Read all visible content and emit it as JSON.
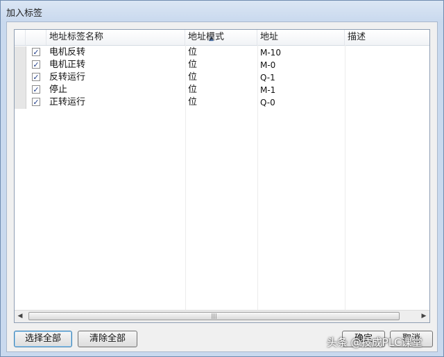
{
  "window": {
    "title": "加入标签"
  },
  "table": {
    "columns": [
      {
        "label": "地址标签名称"
      },
      {
        "label": "地址模式"
      },
      {
        "label": "地址"
      },
      {
        "label": "描述"
      }
    ],
    "rows": [
      {
        "checked": true,
        "check_mark": "✓",
        "name": "电机反转",
        "mode": "位",
        "address": "M-10",
        "desc": ""
      },
      {
        "checked": true,
        "check_mark": "✓",
        "name": "电机正转",
        "mode": "位",
        "address": "M-0",
        "desc": ""
      },
      {
        "checked": true,
        "check_mark": "✓",
        "name": "反转运行",
        "mode": "位",
        "address": "Q-1",
        "desc": ""
      },
      {
        "checked": true,
        "check_mark": "✓",
        "name": "停止",
        "mode": "位",
        "address": "M-1",
        "desc": ""
      },
      {
        "checked": true,
        "check_mark": "✓",
        "name": "正转运行",
        "mode": "位",
        "address": "Q-0",
        "desc": ""
      }
    ],
    "sort_icon": "sort-ascending-icon"
  },
  "buttons": {
    "select_all": "选择全部",
    "clear_all": "清除全部",
    "confirm": "确定",
    "cancel": "取消"
  },
  "watermark": {
    "text": "头条 @技成PLC课堂"
  }
}
